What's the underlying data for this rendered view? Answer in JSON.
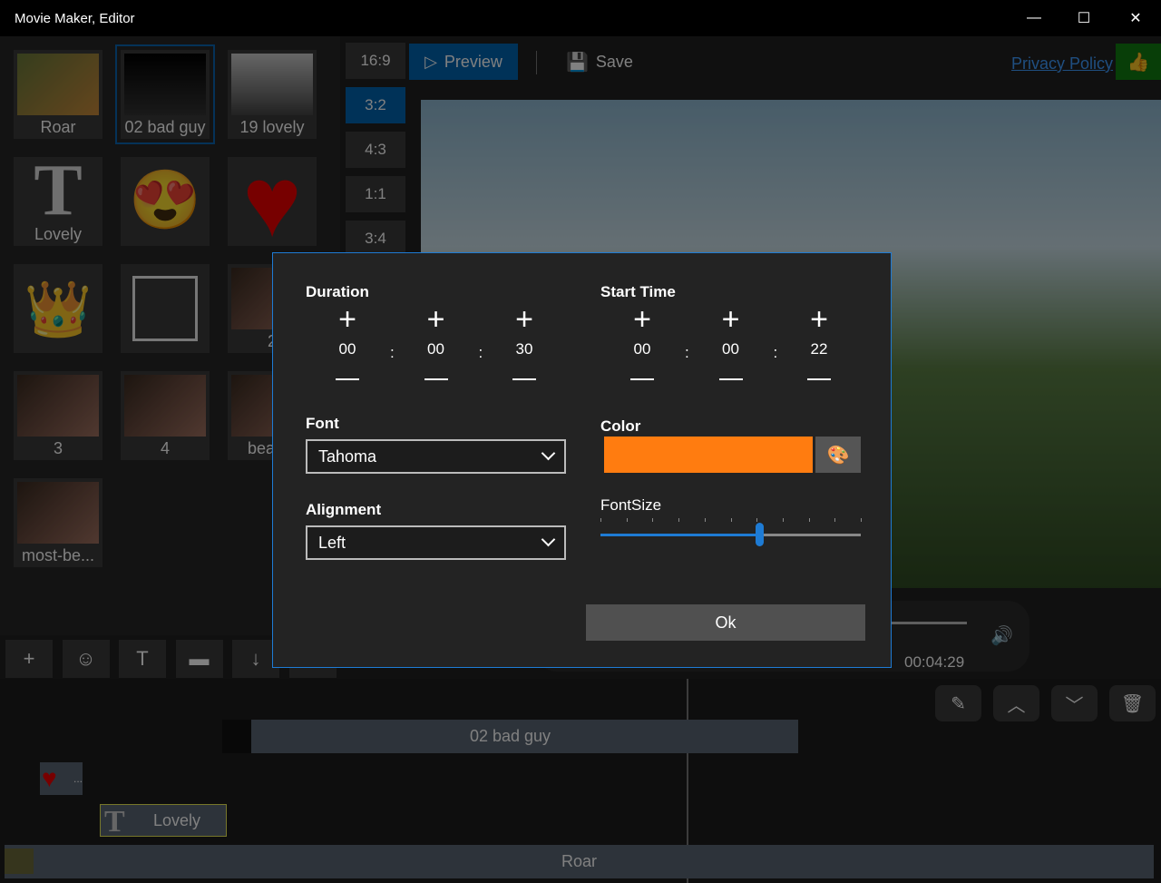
{
  "window": {
    "title": "Movie Maker, Editor",
    "minimize": "—",
    "maximize": "☐",
    "close": "✕"
  },
  "library": [
    {
      "label": "Roar",
      "kind": "video"
    },
    {
      "label": "02 bad guy",
      "kind": "video",
      "selected": true
    },
    {
      "label": "19 lovely",
      "kind": "video"
    },
    {
      "label": "Lovely",
      "kind": "text"
    },
    {
      "label": "",
      "kind": "emoji"
    },
    {
      "label": "",
      "kind": "heart"
    },
    {
      "label": "",
      "kind": "crown"
    },
    {
      "label": "",
      "kind": "frame"
    },
    {
      "label": "2",
      "kind": "image"
    },
    {
      "label": "3",
      "kind": "image"
    },
    {
      "label": "4",
      "kind": "image"
    },
    {
      "label": "beauty",
      "kind": "image"
    },
    {
      "label": "most-be...",
      "kind": "image"
    }
  ],
  "aspect_ratios": [
    "16:9",
    "3:2",
    "4:3",
    "1:1",
    "3:4"
  ],
  "selected_aspect": "3:2",
  "toolbar": {
    "preview": "Preview",
    "save": "Save",
    "privacy": "Privacy Policy"
  },
  "player": {
    "time": "00:04:29"
  },
  "timeline": {
    "tracks": [
      "02 bad guy",
      "...",
      "Lovely",
      "Roar"
    ]
  },
  "dialog": {
    "duration": {
      "label": "Duration",
      "h": "00",
      "m": "00",
      "s": "30"
    },
    "start": {
      "label": "Start Time",
      "h": "00",
      "m": "00",
      "s": "22"
    },
    "sep": ":",
    "font": {
      "label": "Font",
      "value": "Tahoma"
    },
    "alignment": {
      "label": "Alignment",
      "value": "Left"
    },
    "color": {
      "label": "Color",
      "value": "#ff7c10"
    },
    "fontsize": {
      "label": "FontSize",
      "fraction": 0.61
    },
    "ok": "Ok"
  },
  "colors": {
    "accent": "#0063b1",
    "dialog_border": "#1e7bd4",
    "like": "#107c10"
  }
}
